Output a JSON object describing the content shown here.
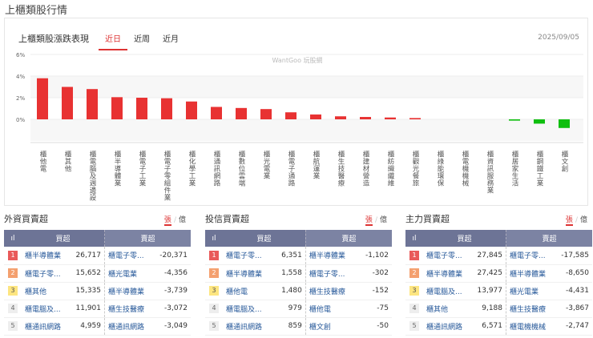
{
  "page_title": "上櫃類股行情",
  "panel": {
    "title": "上櫃類股漲跌表現",
    "tabs": [
      "近日",
      "近周",
      "近月"
    ],
    "active_tab": 0,
    "date": "2025/09/05",
    "watermark": "WantGoo 玩股網"
  },
  "chart_data": {
    "type": "bar",
    "title": "上櫃類股漲跌表現",
    "ylabel": "%",
    "ylim": [
      -2,
      6
    ],
    "yticks": [
      "6%",
      "4%",
      "2%",
      "0%"
    ],
    "yticks_values": [
      6,
      4,
      2,
      0
    ],
    "categories": [
      "櫃他電",
      "櫃其他",
      "櫃電腦及週邊設",
      "櫃半導體業",
      "櫃電子工業",
      "櫃電子零組件業",
      "櫃化學工業",
      "櫃通訊網路",
      "櫃數位雲端",
      "櫃光電業",
      "櫃電子通路",
      "櫃航運業",
      "櫃生技醫療",
      "櫃建材營造",
      "櫃紡織纖維",
      "櫃觀光餐旅",
      "櫃綠能環保",
      "櫃電機機械",
      "櫃資訊服務業",
      "櫃居家生活",
      "櫃鋼鐵工業",
      "櫃文創"
    ],
    "values": [
      3.8,
      3.0,
      2.8,
      2.05,
      2.0,
      1.95,
      1.65,
      1.15,
      1.05,
      0.95,
      0.65,
      0.45,
      0.28,
      0.22,
      0.17,
      0.12,
      0,
      0,
      0,
      -0.12,
      -0.4,
      -0.8
    ],
    "colors": {
      "up": "#e83232",
      "down": "#0fbf0f"
    }
  },
  "sections": [
    {
      "title": "外資買賣超",
      "unit_on": "張",
      "unit_off": "億",
      "head_buy": "買超",
      "head_sell": "賣超",
      "rows": [
        {
          "rank": "1",
          "buy": "櫃半導體業",
          "buy_v": "26,717",
          "sell": "櫃電子零...",
          "sell_v": "-20,371"
        },
        {
          "rank": "2",
          "buy": "櫃電子零...",
          "buy_v": "15,652",
          "sell": "櫃光電業",
          "sell_v": "-4,356"
        },
        {
          "rank": "3",
          "buy": "櫃其他",
          "buy_v": "15,335",
          "sell": "櫃半導體業",
          "sell_v": "-3,739"
        },
        {
          "rank": "4",
          "buy": "櫃電腦及...",
          "buy_v": "11,901",
          "sell": "櫃生技醫療",
          "sell_v": "-3,072"
        },
        {
          "rank": "5",
          "buy": "櫃通訊網路",
          "buy_v": "4,959",
          "sell": "櫃通訊網路",
          "sell_v": "-3,049"
        }
      ]
    },
    {
      "title": "投信買賣超",
      "unit_on": "張",
      "unit_off": "億",
      "head_buy": "買超",
      "head_sell": "賣超",
      "rows": [
        {
          "rank": "1",
          "buy": "櫃電子零...",
          "buy_v": "6,351",
          "sell": "櫃半導體業",
          "sell_v": "-1,102"
        },
        {
          "rank": "2",
          "buy": "櫃半導體業",
          "buy_v": "1,558",
          "sell": "櫃電子零...",
          "sell_v": "-302"
        },
        {
          "rank": "3",
          "buy": "櫃他電",
          "buy_v": "1,480",
          "sell": "櫃生技醫療",
          "sell_v": "-152"
        },
        {
          "rank": "4",
          "buy": "櫃電腦及...",
          "buy_v": "979",
          "sell": "櫃他電",
          "sell_v": "-75"
        },
        {
          "rank": "5",
          "buy": "櫃通訊網路",
          "buy_v": "859",
          "sell": "櫃文創",
          "sell_v": "-50"
        }
      ]
    },
    {
      "title": "主力買賣超",
      "unit_on": "張",
      "unit_off": "億",
      "head_buy": "買超",
      "head_sell": "賣超",
      "rows": [
        {
          "rank": "1",
          "buy": "櫃電子零...",
          "buy_v": "27,845",
          "sell": "櫃電子零...",
          "sell_v": "-17,585"
        },
        {
          "rank": "2",
          "buy": "櫃半導體業",
          "buy_v": "27,425",
          "sell": "櫃半導體業",
          "sell_v": "-8,650"
        },
        {
          "rank": "3",
          "buy": "櫃電腦及...",
          "buy_v": "13,977",
          "sell": "櫃光電業",
          "sell_v": "-4,431"
        },
        {
          "rank": "4",
          "buy": "櫃其他",
          "buy_v": "9,188",
          "sell": "櫃生技醫療",
          "sell_v": "-3,867"
        },
        {
          "rank": "5",
          "buy": "櫃通訊網路",
          "buy_v": "6,571",
          "sell": "櫃電機機械",
          "sell_v": "-2,747"
        }
      ]
    }
  ]
}
